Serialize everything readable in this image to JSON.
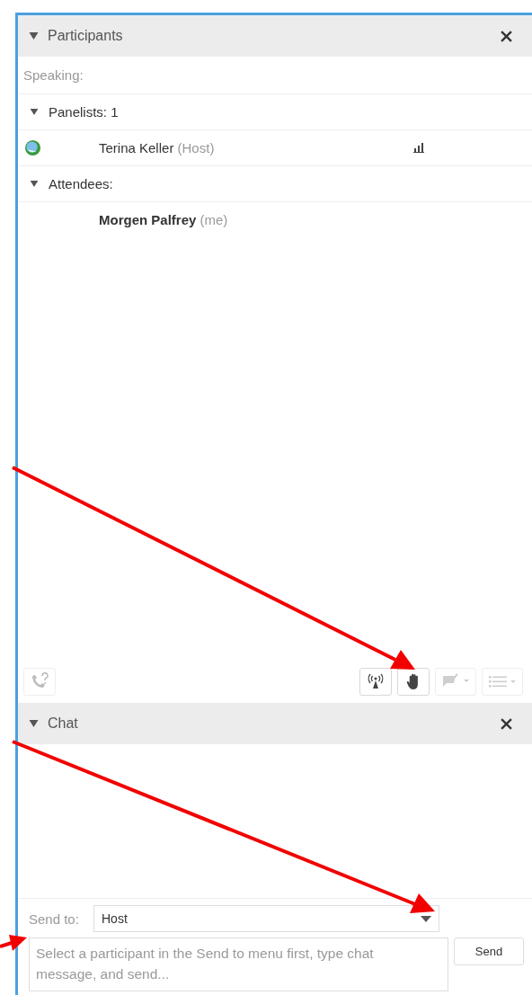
{
  "participants_panel": {
    "title": "Participants",
    "expanded": true,
    "speaking_label": "Speaking:",
    "groups": [
      {
        "label": "Panelists: 1",
        "expanded": true,
        "members": [
          {
            "name": "Terina Keller",
            "role": "(Host)",
            "kind": "host"
          }
        ]
      },
      {
        "label": "Attendees:",
        "expanded": true,
        "members": [
          {
            "name": "Morgen Palfrey",
            "role": "(me)",
            "kind": "self"
          }
        ]
      }
    ],
    "toolbar": [
      {
        "kind": "phone",
        "disabled": true
      },
      {
        "kind": "broadcast",
        "disabled": false
      },
      {
        "kind": "hand",
        "disabled": false
      },
      {
        "kind": "chat",
        "disabled": true
      },
      {
        "kind": "list",
        "disabled": true
      }
    ]
  },
  "chat_panel": {
    "title": "Chat",
    "expanded": true,
    "send_to_label": "Send to:",
    "send_to_value": "Host",
    "message_placeholder": "Select a participant in the Send to menu first, type chat message, and send...",
    "send_button": "Send"
  }
}
